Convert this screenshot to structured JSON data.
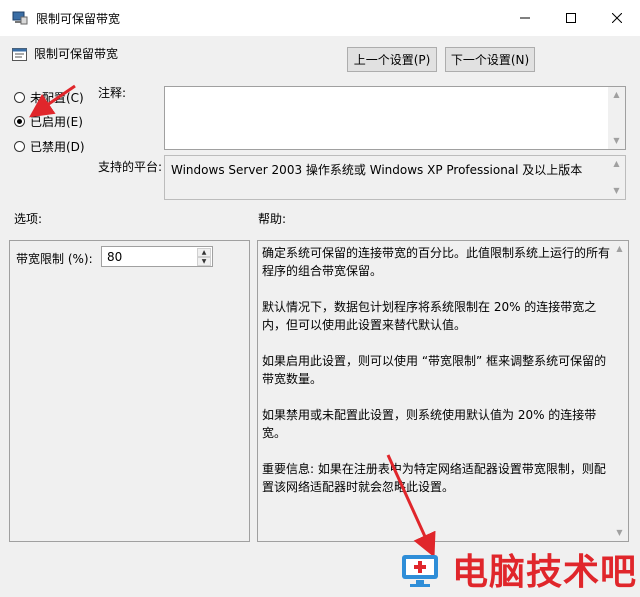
{
  "window": {
    "title": "限制可保留带宽"
  },
  "policy": {
    "title": "限制可保留带宽",
    "prev_label": "上一个设置(P)",
    "next_label": "下一个设置(N)"
  },
  "state": {
    "options": [
      {
        "label": "未配置(C)",
        "checked": false
      },
      {
        "label": "已启用(E)",
        "checked": true
      },
      {
        "label": "已禁用(D)",
        "checked": false
      }
    ]
  },
  "comment": {
    "label": "注释:",
    "value": ""
  },
  "platform": {
    "label": "支持的平台:",
    "value": "Windows Server 2003 操作系统或 Windows XP Professional 及以上版本"
  },
  "options_panel": {
    "header": "选项:",
    "bandwidth_label": "带宽限制 (%):",
    "bandwidth_value": "80"
  },
  "help_panel": {
    "header": "帮助:",
    "paragraphs": [
      "确定系统可保留的连接带宽的百分比。此值限制系统上运行的所有程序的组合带宽保留。",
      "默认情况下，数据包计划程序将系统限制在 20% 的连接带宽之内，但可以使用此设置来替代默认值。",
      "如果启用此设置，则可以使用 “带宽限制” 框来调整系统可保留的带宽数量。",
      "如果禁用或未配置此设置，则系统使用默认值为 20% 的连接带宽。",
      "重要信息: 如果在注册表中为特定网络适配器设置带宽限制，则配置该网络适配器时就会忽略此设置。"
    ]
  },
  "watermark": {
    "text": "电脑技术吧"
  },
  "colors": {
    "annotation_arrow": "#e0262b",
    "watermark": "#e0262b"
  }
}
